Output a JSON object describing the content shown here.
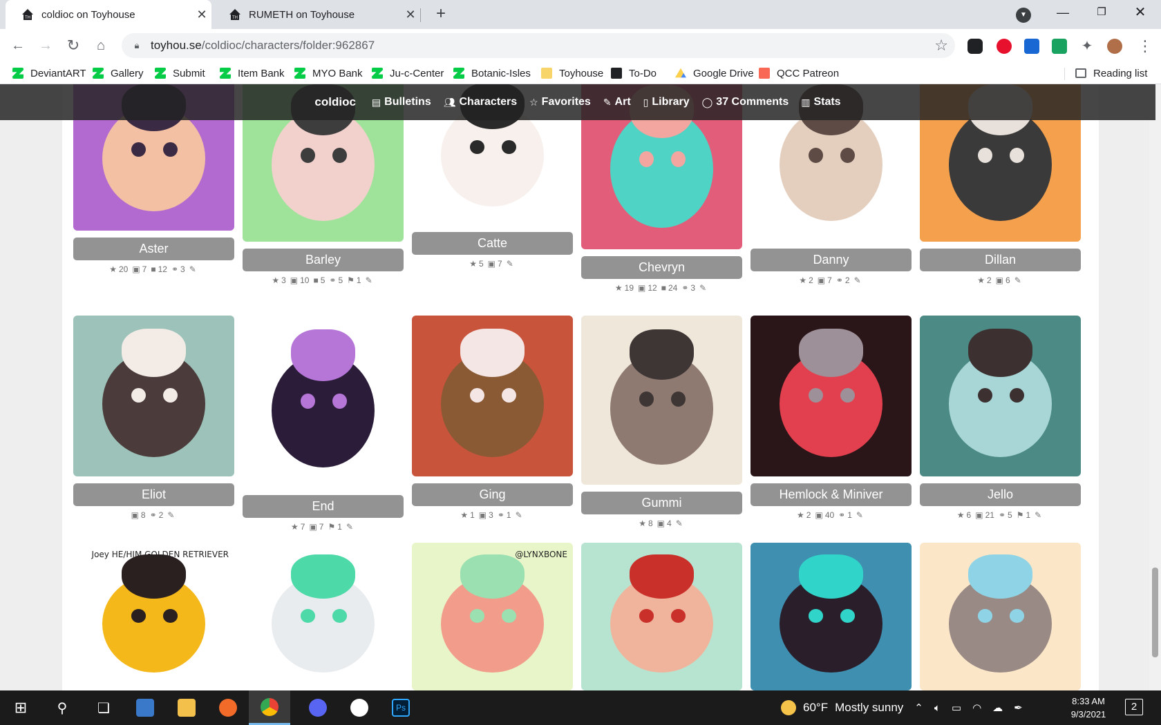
{
  "browser": {
    "tabs": [
      {
        "title": "coldioc on Toyhouse",
        "active": true
      },
      {
        "title": "RUMETH on Toyhouse",
        "active": false
      }
    ],
    "url_host": "toyhou.se",
    "url_path": "/coldioc/characters/folder:962867"
  },
  "bookmarks": [
    {
      "label": "DeviantART",
      "icon": "deviantart-icon"
    },
    {
      "label": "Gallery",
      "icon": "deviantart-icon"
    },
    {
      "label": "Submit",
      "icon": "deviantart-icon"
    },
    {
      "label": "Item Bank",
      "icon": "deviantart-icon"
    },
    {
      "label": "MYO Bank",
      "icon": "deviantart-icon"
    },
    {
      "label": "Ju-c-Center",
      "icon": "deviantart-icon"
    },
    {
      "label": "Botanic-Isles",
      "icon": "deviantart-icon"
    },
    {
      "label": "Toyhouse",
      "icon": "folder-icon"
    },
    {
      "label": "To-Do",
      "icon": "toyhouse-icon"
    },
    {
      "label": "Google Drive",
      "icon": "google-drive-icon"
    },
    {
      "label": "QCC Patreon",
      "icon": "patreon-icon"
    }
  ],
  "reading_list": "Reading list",
  "site_nav": {
    "user": "coldioc",
    "items": [
      {
        "label": "Bulletins",
        "icon": "newspaper-icon"
      },
      {
        "label": "Characters",
        "icon": "users-icon"
      },
      {
        "label": "Favorites",
        "icon": "star-icon"
      },
      {
        "label": "Art",
        "icon": "brush-icon"
      },
      {
        "label": "Library",
        "icon": "book-icon"
      },
      {
        "label": "37 Comments",
        "icon": "comment-icon"
      },
      {
        "label": "Stats",
        "icon": "chart-icon"
      }
    ]
  },
  "characters": [
    {
      "name": "Aster",
      "stats": [
        {
          "icon": "★",
          "value": "20"
        },
        {
          "icon": "▣",
          "value": "7"
        },
        {
          "icon": "■",
          "value": "12"
        },
        {
          "icon": "⚭",
          "value": "3"
        },
        {
          "icon": "✎",
          "value": ""
        }
      ],
      "colors": [
        "#b36ad0",
        "#f3c0a4",
        "#3a2a44"
      ]
    },
    {
      "name": "Barley",
      "stats": [
        {
          "icon": "★",
          "value": "3"
        },
        {
          "icon": "▣",
          "value": "10"
        },
        {
          "icon": "■",
          "value": "5"
        },
        {
          "icon": "⚭",
          "value": "5"
        },
        {
          "icon": "⚑",
          "value": "1"
        },
        {
          "icon": "✎",
          "value": ""
        }
      ],
      "colors": [
        "#9fe39a",
        "#f2d0cc",
        "#3d3d3d"
      ]
    },
    {
      "name": "Catte",
      "stats": [
        {
          "icon": "★",
          "value": "5"
        },
        {
          "icon": "▣",
          "value": "7"
        },
        {
          "icon": "✎",
          "value": ""
        }
      ],
      "colors": [
        "#ffffff",
        "#f8f0ec",
        "#2a2a2a"
      ]
    },
    {
      "name": "Chevryn",
      "stats": [
        {
          "icon": "★",
          "value": "19"
        },
        {
          "icon": "▣",
          "value": "12"
        },
        {
          "icon": "■",
          "value": "24"
        },
        {
          "icon": "⚭",
          "value": "3"
        },
        {
          "icon": "✎",
          "value": ""
        }
      ],
      "colors": [
        "#e25d7a",
        "#4fd3c4",
        "#f3a6a0"
      ]
    },
    {
      "name": "Danny",
      "stats": [
        {
          "icon": "★",
          "value": "2"
        },
        {
          "icon": "▣",
          "value": "7"
        },
        {
          "icon": "⚭",
          "value": "2"
        },
        {
          "icon": "✎",
          "value": ""
        }
      ],
      "colors": [
        "#ffffff",
        "#e4cfbf",
        "#5e4b45"
      ]
    },
    {
      "name": "Dillan",
      "stats": [
        {
          "icon": "★",
          "value": "2"
        },
        {
          "icon": "▣",
          "value": "6"
        },
        {
          "icon": "✎",
          "value": ""
        }
      ],
      "colors": [
        "#f5a04d",
        "#3a3a3a",
        "#e8e0da"
      ]
    },
    {
      "name": "Eliot",
      "stats": [
        {
          "icon": "▣",
          "value": "8"
        },
        {
          "icon": "⚭",
          "value": "2"
        },
        {
          "icon": "✎",
          "value": ""
        }
      ],
      "colors": [
        "#9cc2b9",
        "#4b3b3b",
        "#f2ebe6"
      ]
    },
    {
      "name": "End",
      "stats": [
        {
          "icon": "★",
          "value": "7"
        },
        {
          "icon": "▣",
          "value": "7"
        },
        {
          "icon": "⚑",
          "value": "1"
        },
        {
          "icon": "✎",
          "value": ""
        }
      ],
      "colors": [
        "#ffffff",
        "#2b1d3a",
        "#b676d8"
      ]
    },
    {
      "name": "Ging",
      "stats": [
        {
          "icon": "★",
          "value": "1"
        },
        {
          "icon": "▣",
          "value": "3"
        },
        {
          "icon": "⚭",
          "value": "1"
        },
        {
          "icon": "✎",
          "value": ""
        }
      ],
      "colors": [
        "#c9543c",
        "#8a5a34",
        "#f5e6e6"
      ]
    },
    {
      "name": "Gummi",
      "stats": [
        {
          "icon": "★",
          "value": "8"
        },
        {
          "icon": "▣",
          "value": "4"
        },
        {
          "icon": "✎",
          "value": ""
        }
      ],
      "colors": [
        "#efe7da",
        "#8e7a70",
        "#3e3535"
      ]
    },
    {
      "name": "Hemlock & Miniver",
      "stats": [
        {
          "icon": "★",
          "value": "2"
        },
        {
          "icon": "▣",
          "value": "40"
        },
        {
          "icon": "⚭",
          "value": "1"
        },
        {
          "icon": "✎",
          "value": ""
        }
      ],
      "colors": [
        "#2a1518",
        "#e2404e",
        "#9e9098"
      ]
    },
    {
      "name": "Jello",
      "stats": [
        {
          "icon": "★",
          "value": "6"
        },
        {
          "icon": "▣",
          "value": "21"
        },
        {
          "icon": "⚭",
          "value": "5"
        },
        {
          "icon": "⚑",
          "value": "1"
        },
        {
          "icon": "✎",
          "value": ""
        }
      ],
      "colors": [
        "#4c8a86",
        "#a8d6d6",
        "#3c3030"
      ]
    },
    {
      "name": "",
      "stats": [],
      "colors": [
        "#ffffff",
        "#f5b81a",
        "#2a2020"
      ],
      "caption": "Joey HE/HIM GOLDEN RETRIEVER"
    },
    {
      "name": "",
      "stats": [],
      "colors": [
        "#ffffff",
        "#e8ecef",
        "#4ed9a8"
      ]
    },
    {
      "name": "",
      "stats": [],
      "colors": [
        "#e8f5c8",
        "#f29c8c",
        "#9ae0b0"
      ],
      "caption": "@LYNXBONE"
    },
    {
      "name": "",
      "stats": [],
      "colors": [
        "#b7e4d0",
        "#f0b49c",
        "#c9302a"
      ]
    },
    {
      "name": "",
      "stats": [],
      "colors": [
        "#3f8fb0",
        "#2a1e2a",
        "#30d4c8"
      ]
    },
    {
      "name": "",
      "stats": [],
      "colors": [
        "#fbe6c8",
        "#9a8a86",
        "#8fd4e6"
      ]
    }
  ],
  "taskbar": {
    "weather_temp": "60°F",
    "weather_text": "Mostly sunny",
    "time": "8:33 AM",
    "date": "9/3/2021",
    "notifications": "2"
  }
}
